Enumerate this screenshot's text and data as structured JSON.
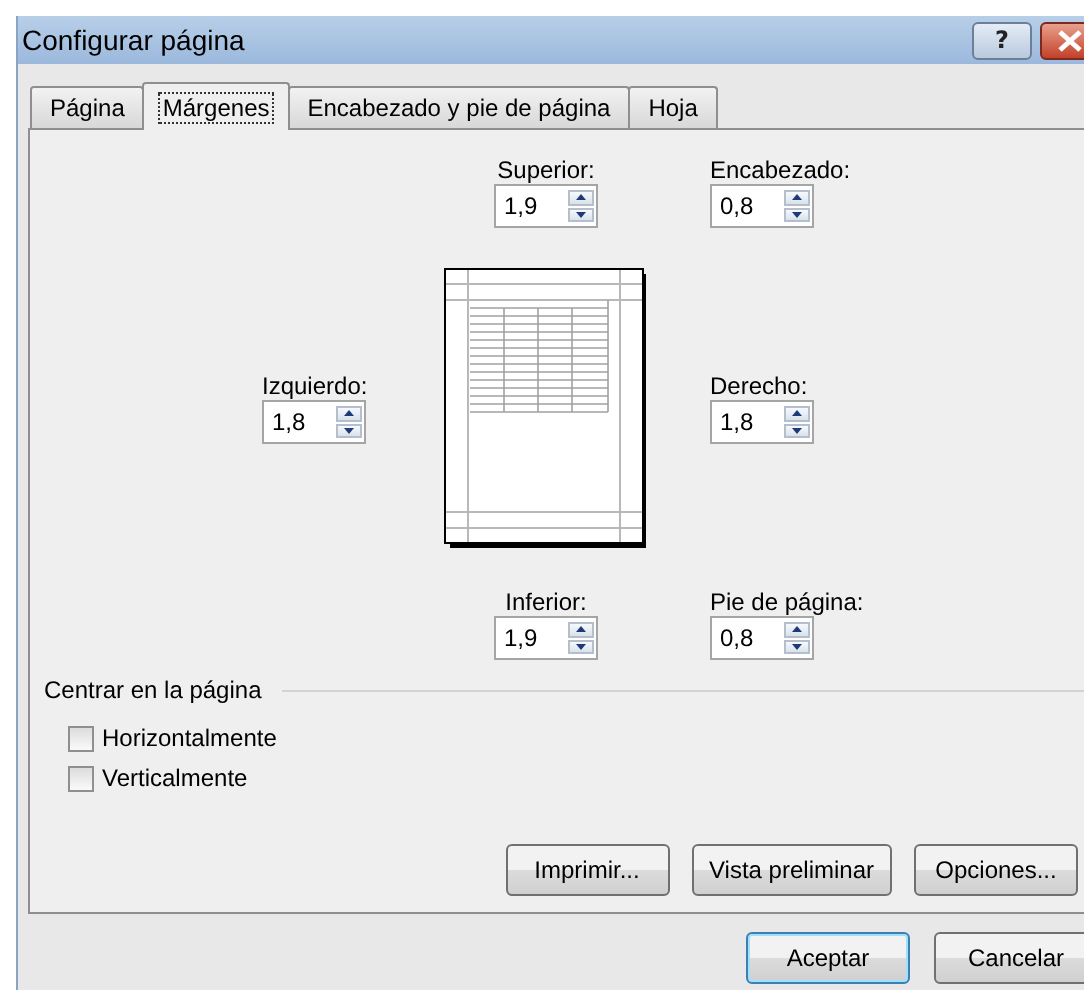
{
  "window": {
    "title": "Configurar página",
    "help_button": "?"
  },
  "tabs": [
    {
      "label": "Página",
      "selected": false
    },
    {
      "label": "Márgenes",
      "selected": true
    },
    {
      "label": "Encabezado y pie de página",
      "selected": false
    },
    {
      "label": "Hoja",
      "selected": false
    }
  ],
  "margin_fields": [
    {
      "kind": "top",
      "label": "Superior:",
      "value": "1,9"
    },
    {
      "kind": "header",
      "label": "Encabezado:",
      "value": "0,8"
    },
    {
      "kind": "left",
      "label": "Izquierdo:",
      "value": "1,8"
    },
    {
      "kind": "right",
      "label": "Derecho:",
      "value": "1,8"
    },
    {
      "kind": "bottom",
      "label": "Inferior:",
      "value": "1,9"
    },
    {
      "kind": "footer",
      "label": "Pie de página:",
      "value": "0,8"
    }
  ],
  "center_on_page": {
    "title": "Centrar en la página",
    "options": [
      {
        "label": "Horizontalmente",
        "checked": false
      },
      {
        "label": "Verticalmente",
        "checked": false
      }
    ]
  },
  "panel_buttons": [
    "Imprimir...",
    "Vista preliminar",
    "Opciones..."
  ],
  "dialog_buttons": [
    {
      "label": "Aceptar",
      "default": true
    },
    {
      "label": "Cancelar",
      "default": false
    }
  ]
}
